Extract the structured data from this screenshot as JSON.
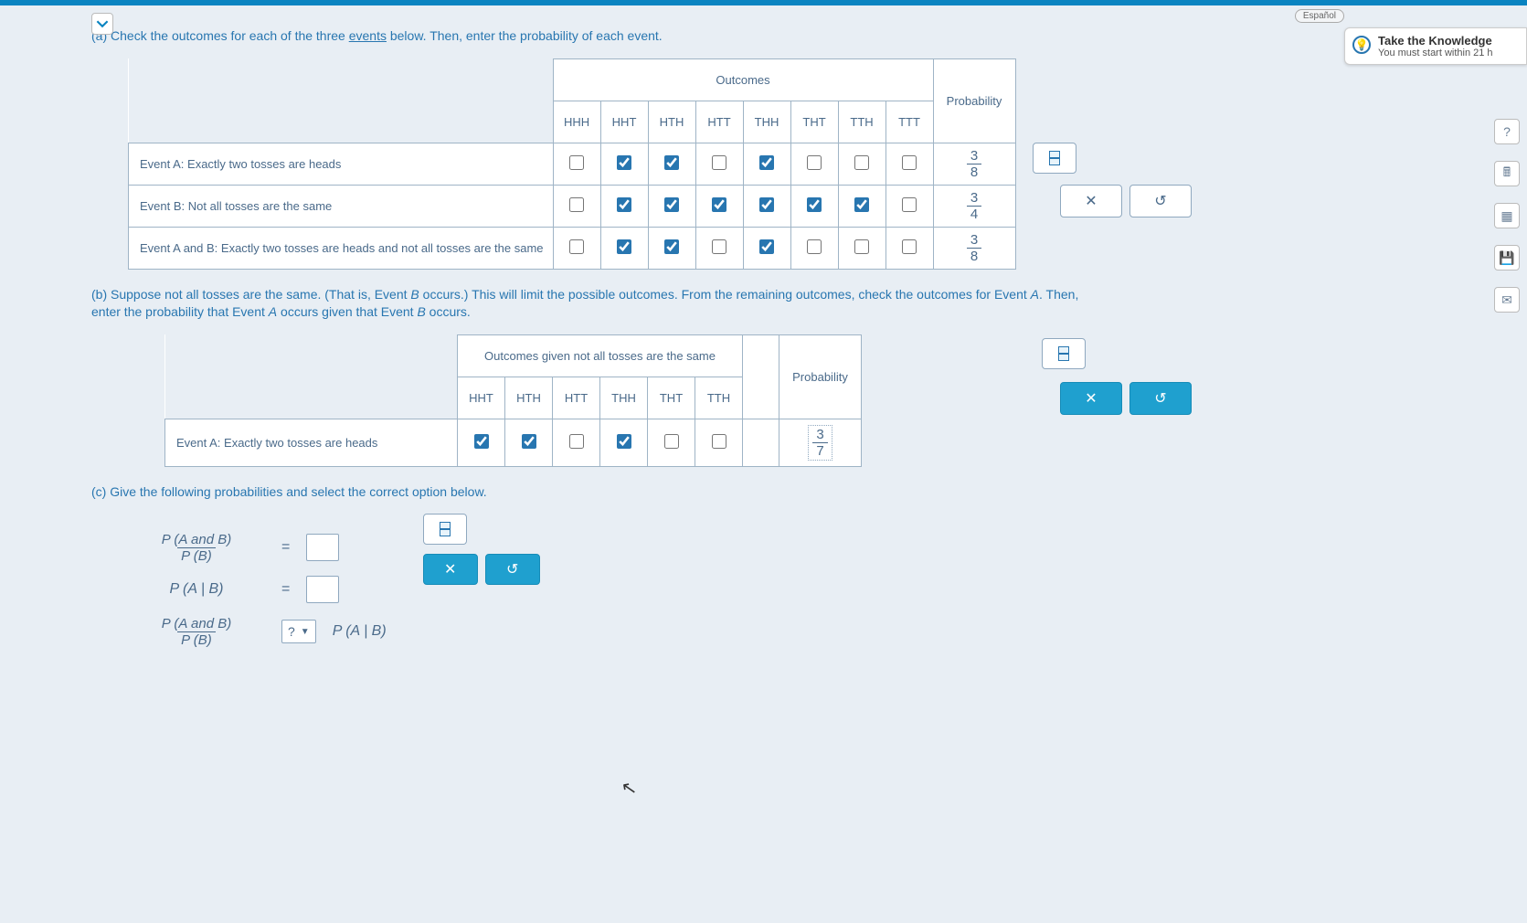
{
  "espanol_label": "Español",
  "knowledge": {
    "title": "Take the Knowledge",
    "subtitle": "You must start within 21 h",
    "icon": "lightbulb"
  },
  "part_a": {
    "label": "(a)",
    "intro_pre": "Check the outcomes for each of the three ",
    "intro_link": "events",
    "intro_post": " below. Then, enter the probability of each event.",
    "outcomes_header": "Outcomes",
    "prob_header": "Probability",
    "outcome_labels": [
      "HHH",
      "HHT",
      "HTH",
      "HTT",
      "THH",
      "THT",
      "TTH",
      "TTT"
    ],
    "rows": [
      {
        "label": "Event A: Exactly two tosses are heads",
        "checks": [
          false,
          true,
          true,
          false,
          true,
          false,
          false,
          false
        ],
        "prob_num": "3",
        "prob_den": "8"
      },
      {
        "label": "Event B: Not all tosses are the same",
        "checks": [
          false,
          true,
          true,
          true,
          true,
          true,
          true,
          false
        ],
        "prob_num": "3",
        "prob_den": "4"
      },
      {
        "label": "Event A and B: Exactly two tosses are heads and not all tosses are the same",
        "checks": [
          false,
          true,
          true,
          false,
          true,
          false,
          false,
          false
        ],
        "prob_num": "3",
        "prob_den": "8"
      }
    ]
  },
  "part_b": {
    "label": "(b)",
    "text_1": "Suppose not all tosses are the same. (That is, Event ",
    "text_B1": "B",
    "text_2": " occurs.) This will limit the possible outcomes. From the remaining outcomes, check the outcomes for Event ",
    "text_A1": "A",
    "text_3": ". Then, enter the probability that Event ",
    "text_A2": "A",
    "text_4": " occurs given that Event ",
    "text_B2": "B",
    "text_5": " occurs.",
    "outcomes_header": "Outcomes given not all tosses are the same",
    "prob_header": "Probability",
    "outcome_labels": [
      "HHT",
      "HTH",
      "HTT",
      "THH",
      "THT",
      "TTH"
    ],
    "row": {
      "label": "Event A: Exactly two tosses are heads",
      "checks": [
        true,
        true,
        false,
        true,
        false,
        false
      ],
      "prob_num": "3",
      "prob_den": "7"
    }
  },
  "part_c": {
    "label": "(c)",
    "intro": "Give the following probabilities and select the correct option below.",
    "eq1_lhs_num": "P (A and B)",
    "eq1_lhs_den": "P (B)",
    "equals": "=",
    "eq2_lhs": "P (A | B)",
    "eq3_lhs_num": "P (A and B)",
    "eq3_lhs_den": "P (B)",
    "select_placeholder": "?",
    "eq3_rhs": "P (A | B)"
  },
  "buttons": {
    "clear": "✕",
    "reset": "↺"
  },
  "sidebar_icons": [
    "?",
    "calc",
    "grid",
    "save",
    "mail"
  ]
}
